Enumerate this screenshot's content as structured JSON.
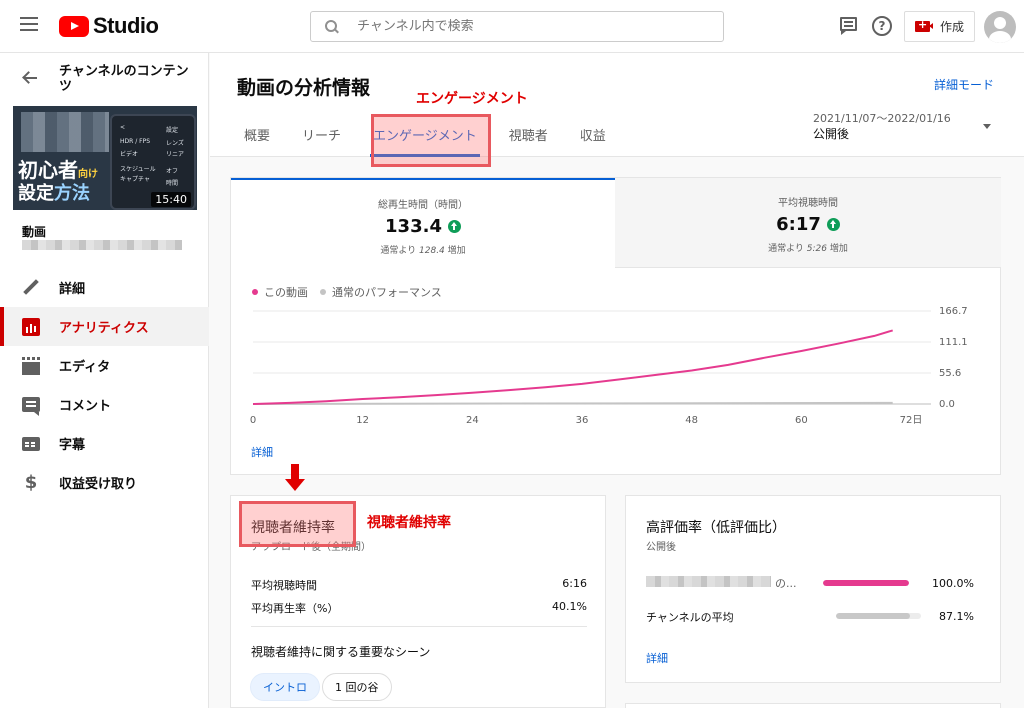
{
  "header": {
    "logo_text": "Studio",
    "search_placeholder": "チャンネル内で検索",
    "create_label": "作成"
  },
  "sidebar": {
    "channel_title": "チャンネルのコンテンツ",
    "thumbnail": {
      "text_line1": "初心者",
      "text_line1_small": "向け",
      "text_line2_a": "設定",
      "text_line2_b": "方法",
      "duration": "15:40"
    },
    "video_label": "動画",
    "nav": [
      {
        "label": "詳細",
        "icon": "pencil-icon",
        "active": false
      },
      {
        "label": "アナリティクス",
        "icon": "analytics-icon",
        "active": true
      },
      {
        "label": "エディタ",
        "icon": "editor-icon",
        "active": false
      },
      {
        "label": "コメント",
        "icon": "comment-icon",
        "active": false
      },
      {
        "label": "字幕",
        "icon": "subtitles-icon",
        "active": false
      },
      {
        "label": "収益受け取り",
        "icon": "dollar-icon",
        "active": false
      }
    ]
  },
  "main": {
    "title": "動画の分析情報",
    "advanced_mode": "詳細モード",
    "annotation_engagement": "エンゲージメント",
    "tabs": [
      {
        "label": "概要",
        "active": false
      },
      {
        "label": "リーチ",
        "active": false
      },
      {
        "label": "エンゲージメント",
        "active": true
      },
      {
        "label": "視聴者",
        "active": false
      },
      {
        "label": "収益",
        "active": false
      }
    ],
    "date_range": "2021/11/07〜2022/01/16",
    "date_label": "公開後"
  },
  "metrics": [
    {
      "label": "総再生時間（時間）",
      "value": "133.4",
      "sub_prefix": "通常より ",
      "sub_value": "128.4",
      "sub_suffix": " 増加"
    },
    {
      "label": "平均視聴時間",
      "value": "6:17",
      "sub_prefix": "通常より ",
      "sub_value": "5:26",
      "sub_suffix": " 増加"
    }
  ],
  "legend": {
    "this_video": "この動画",
    "typical": "通常のパフォーマンス"
  },
  "detail_link": "詳細",
  "chart_data": {
    "type": "line",
    "x_ticks": [
      "0",
      "12",
      "24",
      "36",
      "48",
      "60",
      "72日"
    ],
    "y_ticks": [
      "0.0",
      "55.6",
      "111.1",
      "166.7"
    ],
    "ylim": [
      0,
      166.7
    ],
    "xlim": [
      0,
      72
    ],
    "series": [
      {
        "name": "この動画",
        "color": "#e53a8f",
        "x": [
          0,
          4,
          8,
          12,
          16,
          20,
          24,
          28,
          32,
          36,
          40,
          44,
          48,
          52,
          56,
          60,
          64,
          68,
          70
        ],
        "y": [
          0,
          2,
          5,
          9,
          12,
          16,
          20,
          25,
          30,
          36,
          44,
          52,
          60,
          70,
          83,
          95,
          108,
          122,
          132
        ]
      },
      {
        "name": "通常のパフォーマンス",
        "color": "#c4c4c4",
        "x": [
          0,
          70
        ],
        "y": [
          0,
          2
        ]
      }
    ]
  },
  "retention": {
    "title": "視聴者維持率",
    "subtitle": "アップロード後（全期間）",
    "annotation": "視聴者維持率",
    "rows": [
      {
        "label": "平均視聴時間",
        "value": "6:16"
      },
      {
        "label": "平均再生率（%）",
        "value": "40.1%"
      }
    ],
    "scenes_title": "視聴者維持に関する重要なシーン",
    "chips": [
      "イントロ",
      "1 回の谷"
    ]
  },
  "likes": {
    "title": "高評価率（低評価比）",
    "subtitle": "公開後",
    "this_video_suffix": "の...",
    "this_video_pct": "100.0%",
    "this_video_value": 1.0,
    "channel_label": "チャンネルの平均",
    "channel_pct": "87.1%",
    "channel_value": 0.871,
    "detail": "詳細",
    "bar_color_video": "#e53a8f",
    "bar_color_channel": "#c8c8c8"
  }
}
